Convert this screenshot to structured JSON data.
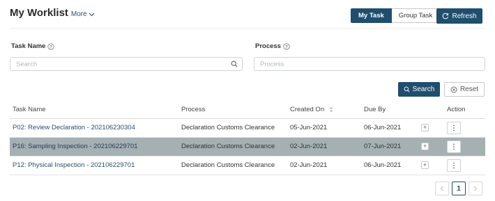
{
  "header": {
    "title": "My Worklist",
    "more_label": "More"
  },
  "view_toggle": {
    "my_task": "My Task",
    "group_task": "Group Task"
  },
  "refresh_label": "Refresh",
  "filters": {
    "task_name_label": "Task Name",
    "task_name_placeholder": "Search",
    "process_label": "Process",
    "process_placeholder": "Process"
  },
  "search_label": "Search",
  "reset_label": "Reset",
  "table": {
    "columns": [
      "Task Name",
      "Process",
      "Created On",
      "Due By",
      "",
      "Action"
    ],
    "rows": [
      {
        "task": "P02: Review Declaration - 202106230304",
        "process": "Declaration Customs Clearance",
        "created": "05-Jun-2021",
        "due": "06-Jun-2021"
      },
      {
        "task": "P16: Sampling Inspection - 202106229701",
        "process": "Declaration Customs Clearance",
        "created": "02-Jun-2021",
        "due": "07-Jun-2021"
      },
      {
        "task": "P12: Physical Inspection - 202106229701",
        "process": "Declaration Customs Clearance",
        "created": "02-Jun-2021",
        "due": "06-Jun-2021"
      }
    ],
    "selected_row": 1
  },
  "pagination": {
    "current_page": "1"
  },
  "colors": {
    "primary": "#1f4e6e",
    "selected_row": "#a5b0b3",
    "link": "#2c4d6e"
  },
  "icons": [
    "chevron-down-icon",
    "refresh-icon",
    "help-circle-icon",
    "search-icon",
    "reset-icon",
    "sort-icon",
    "plus-icon",
    "kebab-icon",
    "chevron-left-icon",
    "chevron-right-icon"
  ]
}
